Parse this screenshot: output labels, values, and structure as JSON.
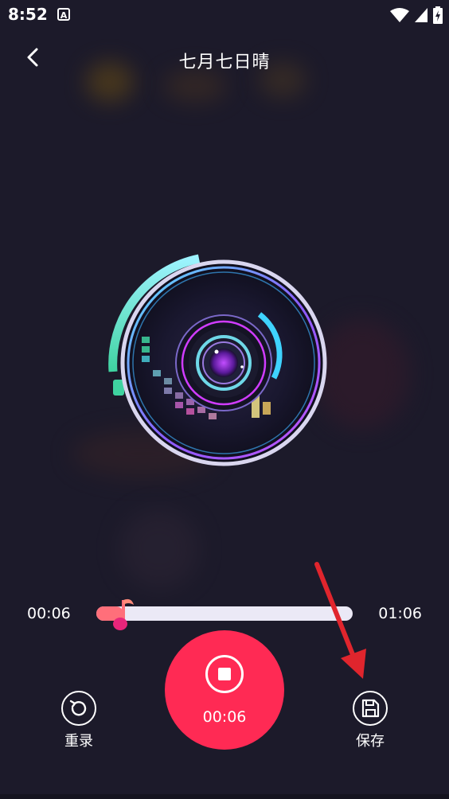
{
  "status_bar": {
    "time": "8:52",
    "app_icon_letter": "A"
  },
  "header": {
    "title": "七月七日晴",
    "back_icon": "chevron-left-icon"
  },
  "player": {
    "current_time": "00:06",
    "total_time": "01:06",
    "progress_fraction": 0.1,
    "record_time": "00:06"
  },
  "controls": {
    "rerecord_label": "重录",
    "save_label": "保存"
  },
  "colors": {
    "background": "#1c1a2a",
    "accent_red": "#ff2a54",
    "progress_fill": "#ff6f7a",
    "annotation_arrow": "#e0252d"
  }
}
